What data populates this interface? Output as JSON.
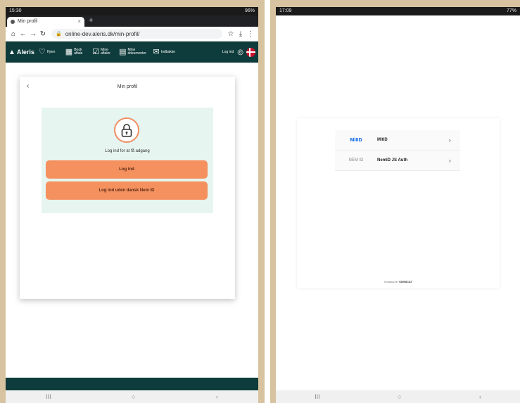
{
  "left_device": {
    "status": {
      "time": "15:30",
      "right": "96%"
    },
    "tab": {
      "title": "Min profil",
      "close": "×",
      "new": "+"
    },
    "url": "online-dev.aleris.dk/min-profil/",
    "nav": {
      "logo": "Aleris",
      "items": [
        {
          "label": "Hjem"
        },
        {
          "label": "Book aftale"
        },
        {
          "label": "Mine aftaler"
        },
        {
          "label": "Mine dokumenter"
        },
        {
          "label": "Indbakke"
        }
      ],
      "login": "Log ind"
    },
    "card": {
      "back": "‹",
      "title": "Min profil",
      "prompt": "Log ind for at få adgang",
      "login_button": "Log ind",
      "login_no_nemid_button": "Log ind uden dansk Nem ID"
    },
    "android": {
      "recents": "III",
      "home": "○",
      "back": "‹"
    },
    "colors": {
      "brand": "#0e3b3c",
      "accent": "#f5915f",
      "panel": "#e6f5ef"
    }
  },
  "right_device": {
    "status": {
      "time": "17:09",
      "right": "77%"
    },
    "providers": [
      {
        "logo": "MitID",
        "name": "MitID"
      },
      {
        "logo": "NEM ID",
        "name": "NemID JS Auth"
      }
    ],
    "powered_by": "POWERED BY",
    "powered_brand": "SIGNICAT",
    "android": {
      "recents": "III",
      "home": "○",
      "back": "‹"
    }
  }
}
